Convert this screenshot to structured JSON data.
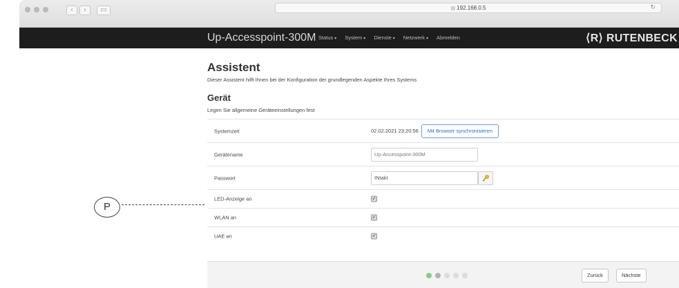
{
  "browser": {
    "url": "192.168.0.5",
    "back_icon": "chevron-left-icon",
    "forward_icon": "chevron-right-icon",
    "sidebar_icon": "sidebar-icon",
    "reload_icon": "reload-icon"
  },
  "navbar": {
    "brand": "Up-Accesspoint-300M",
    "menu": [
      {
        "label": "Status"
      },
      {
        "label": "System"
      },
      {
        "label": "Dienste"
      },
      {
        "label": "Netzwerk"
      },
      {
        "label": "Abmelden"
      }
    ],
    "logo": "⟨R⟩ RUTENBECK"
  },
  "page": {
    "title": "Assistent",
    "subtitle": "Dieser Assistent hilft Ihnen bei der Konfiguration der grundlegenden Aspekte Ihres Systems",
    "section_title": "Gerät",
    "section_subtitle": "Legen Sie allgemeine Geräteeinstellungen fest"
  },
  "form": {
    "systemzeit": {
      "label": "Systemzeit",
      "value": "02.02.2021 23:20:56",
      "sync_button": "Mit Browser synchronisieren"
    },
    "geraetename": {
      "label": "Gerätename",
      "placeholder": "Up-Accesspoint-300M"
    },
    "passwort": {
      "label": "Passwort",
      "value": "INtakt"
    },
    "led": {
      "label": "LED-Anzeige an",
      "checked": true
    },
    "wlan": {
      "label": "WLAN an",
      "checked": true
    },
    "uae": {
      "label": "UAE an",
      "checked": true
    }
  },
  "footer": {
    "steps_total": 5,
    "steps_active": 1,
    "back_button": "Zurück",
    "next_button": "Nächste"
  },
  "callout": {
    "label": "P"
  },
  "colors": {
    "navbar_bg": "#1d1d1d",
    "link_blue": "#2a6fbf",
    "step_active": "#7fcf88"
  }
}
